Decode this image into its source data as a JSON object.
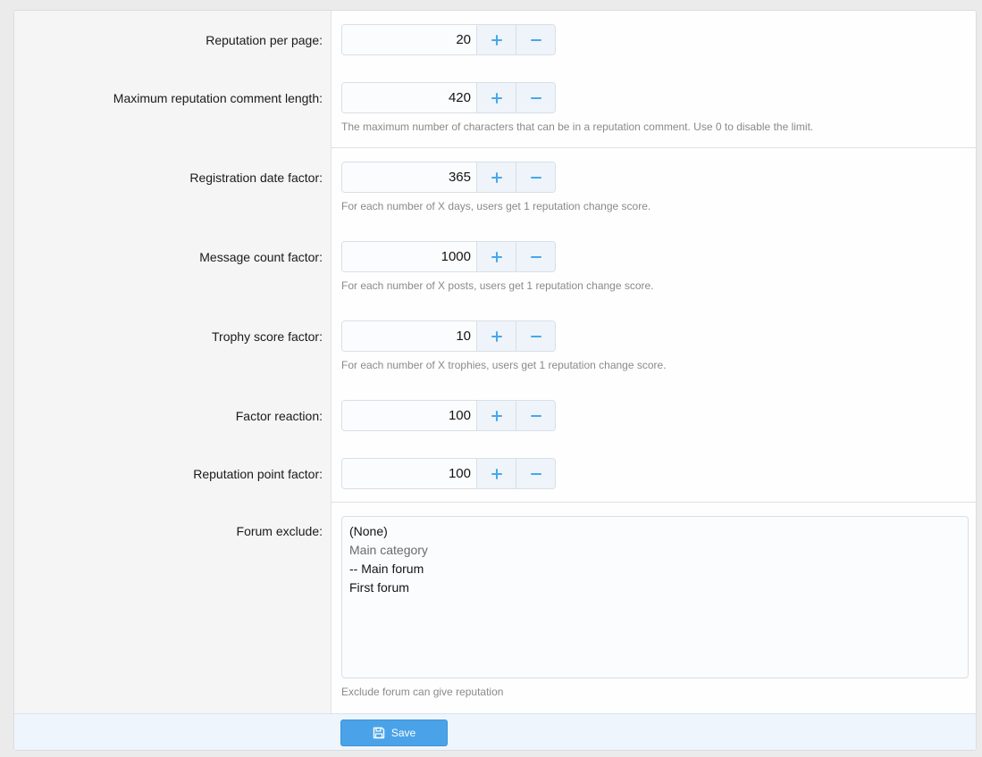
{
  "form": {
    "fields": [
      {
        "label": "Reputation per page:",
        "value": "20",
        "hint": ""
      },
      {
        "label": "Maximum reputation comment length:",
        "value": "420",
        "hint": "The maximum number of characters that can be in a reputation comment. Use 0 to disable the limit."
      },
      {
        "label": "Registration date factor:",
        "value": "365",
        "hint": "For each number of X days, users get 1 reputation change score."
      },
      {
        "label": "Message count factor:",
        "value": "1000",
        "hint": "For each number of X posts, users get 1 reputation change score."
      },
      {
        "label": "Trophy score factor:",
        "value": "10",
        "hint": "For each number of X trophies, users get 1 reputation change score."
      },
      {
        "label": "Factor reaction:",
        "value": "100",
        "hint": ""
      },
      {
        "label": "Reputation point factor:",
        "value": "100",
        "hint": ""
      }
    ],
    "forum_exclude": {
      "label": "Forum exclude:",
      "options": [
        "(None)",
        "Main category",
        "-- Main forum",
        "First forum"
      ],
      "hint": "Exclude forum can give reputation"
    }
  },
  "footer": {
    "save_label": "Save"
  },
  "colors": {
    "accent": "#4aa3e8",
    "spinner_icon": "#47a7eb",
    "label_column_bg": "#f5f5f5",
    "footer_bg": "#eef5fc"
  }
}
